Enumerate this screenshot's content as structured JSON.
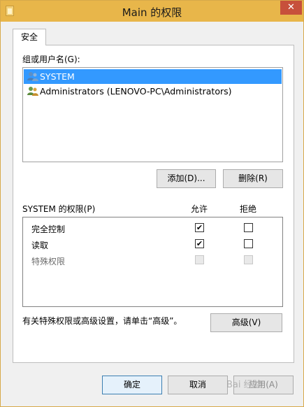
{
  "window": {
    "title": "Main 的权限",
    "close_glyph": "✕"
  },
  "tabs": [
    {
      "label": "安全"
    }
  ],
  "users": {
    "label": "组或用户名(G):",
    "items": [
      {
        "name": "SYSTEM",
        "selected": true
      },
      {
        "name": "Administrators (LENOVO-PC\\Administrators)",
        "selected": false
      }
    ],
    "add_button": "添加(D)...",
    "remove_button": "删除(R)"
  },
  "permissions": {
    "title": "SYSTEM 的权限(P)",
    "allow_header": "允许",
    "deny_header": "拒绝",
    "rows": [
      {
        "name": "完全控制",
        "allow": true,
        "deny": false,
        "disabled": false
      },
      {
        "name": "读取",
        "allow": true,
        "deny": false,
        "disabled": false
      },
      {
        "name": "特殊权限",
        "allow": false,
        "deny": false,
        "disabled": true
      }
    ]
  },
  "advanced": {
    "text": "有关特殊权限或高级设置，请单击“高级”。",
    "button": "高级(V)"
  },
  "footer": {
    "ok": "确定",
    "cancel": "取消",
    "apply": "应用(A)"
  },
  "watermark": "Bai 经验"
}
